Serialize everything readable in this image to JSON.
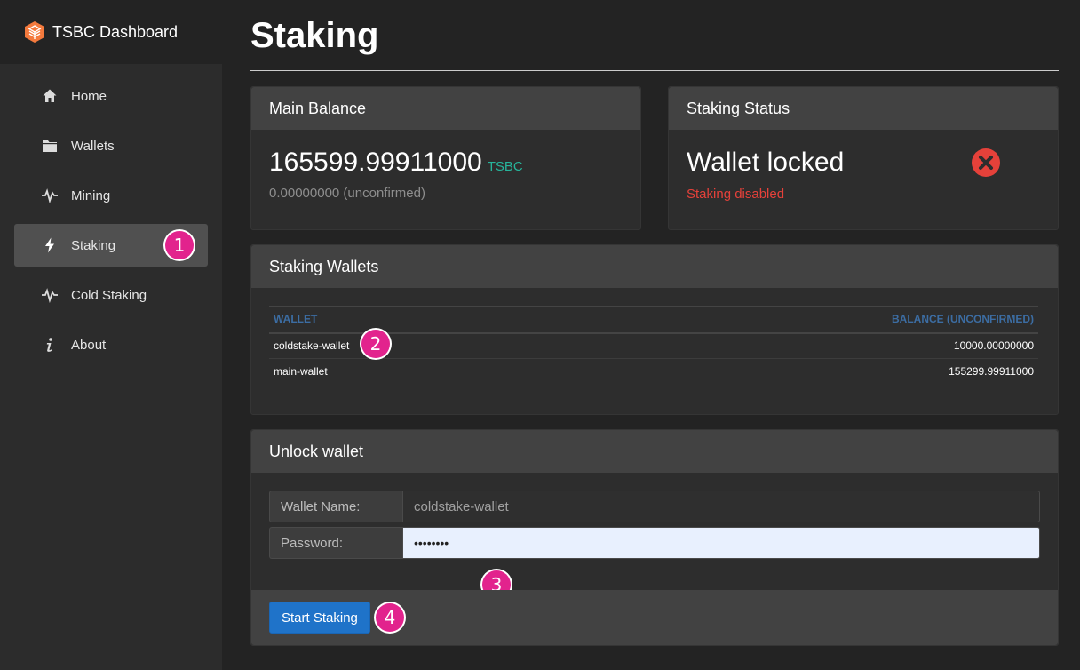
{
  "brand": {
    "name": "TSBC Dashboard",
    "accent": "#f47a3d"
  },
  "sidebar": {
    "items": [
      {
        "label": "Home",
        "icon": "home-icon"
      },
      {
        "label": "Wallets",
        "icon": "folder-icon"
      },
      {
        "label": "Mining",
        "icon": "activity-icon"
      },
      {
        "label": "Staking",
        "icon": "bolt-icon",
        "active": true
      },
      {
        "label": "Cold Staking",
        "icon": "activity-icon"
      },
      {
        "label": "About",
        "icon": "info-icon"
      }
    ]
  },
  "page": {
    "title": "Staking"
  },
  "balance": {
    "header": "Main Balance",
    "amount": "165599.99911000",
    "unit": "TSBC",
    "unconfirmed": "0.00000000 (unconfirmed)"
  },
  "status": {
    "header": "Staking Status",
    "title": "Wallet locked",
    "subtitle": "Staking disabled",
    "icon": "error-circle-icon",
    "color": "#e5413a"
  },
  "wallets": {
    "header": "Staking Wallets",
    "columns": [
      "Wallet",
      "Balance (unconfirmed)"
    ],
    "rows": [
      {
        "name": "coldstake-wallet",
        "balance": "10000.00000000"
      },
      {
        "name": "main-wallet",
        "balance": "155299.99911000"
      }
    ]
  },
  "unlock": {
    "header": "Unlock wallet",
    "wallet_label": "Wallet Name:",
    "wallet_value": "coldstake-wallet",
    "password_label": "Password:",
    "password_value": "••••••••",
    "button": "Start Staking"
  },
  "annotations": [
    "1",
    "2",
    "3",
    "4"
  ]
}
